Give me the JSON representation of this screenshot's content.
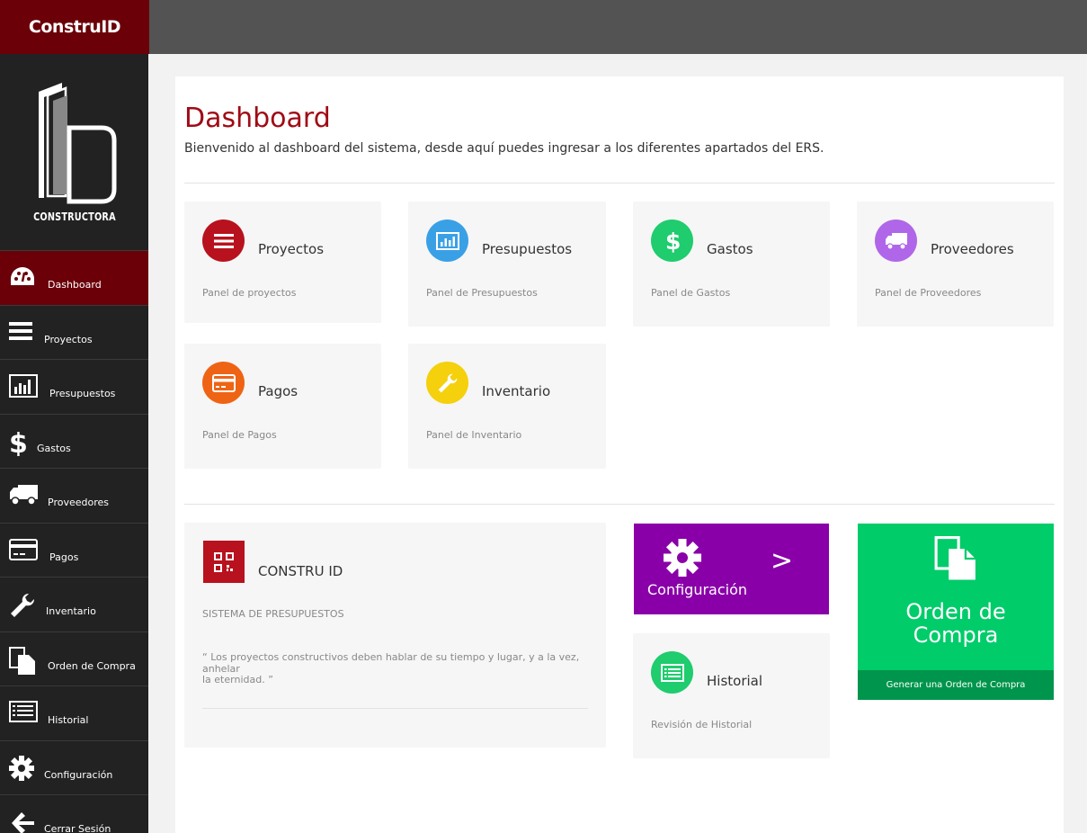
{
  "brand": "ConstruID",
  "logo_text": "CONSTRUCTORA",
  "sidebar": {
    "items": [
      {
        "label": "Dashboard",
        "icon": "dashboard-icon"
      },
      {
        "label": "Proyectos",
        "icon": "list-icon"
      },
      {
        "label": "Presupuestos",
        "icon": "bar-chart-icon"
      },
      {
        "label": "Gastos",
        "icon": "dollar-icon"
      },
      {
        "label": "Proveedores",
        "icon": "truck-icon"
      },
      {
        "label": "Pagos",
        "icon": "credit-card-icon"
      },
      {
        "label": "Inventario",
        "icon": "wrench-icon"
      },
      {
        "label": "Orden de Compra",
        "icon": "documents-icon"
      },
      {
        "label": "Historial",
        "icon": "history-list-icon"
      },
      {
        "label": "Configuración",
        "icon": "gear-icon"
      },
      {
        "label": "Cerrar Sesión",
        "icon": "arrow-left-icon"
      }
    ]
  },
  "main": {
    "title": "Dashboard",
    "subtitle": "Bienvenido al dashboard del sistema, desde aquí puedes ingresar a los diferentes apartados del ERS.",
    "cards": [
      {
        "title": "Proyectos",
        "desc": "Panel de proyectos",
        "color": "#b8121e",
        "icon": "list-icon"
      },
      {
        "title": "Presupuestos",
        "desc": "Panel de Presupuestos",
        "color": "#3aa0e6",
        "icon": "bar-chart-icon"
      },
      {
        "title": "Gastos",
        "desc": "Panel de Gastos",
        "color": "#1fcc6e",
        "icon": "dollar-icon"
      },
      {
        "title": "Proveedores",
        "desc": "Panel de Proveedores",
        "color": "#b066e8",
        "icon": "truck-icon"
      },
      {
        "title": "Pagos",
        "desc": "Panel de Pagos",
        "color": "#ee6414",
        "icon": "credit-card-icon"
      },
      {
        "title": "Inventario",
        "desc": "Panel de Inventario",
        "color": "#f5d00c",
        "icon": "wrench-icon"
      }
    ],
    "about": {
      "title": "CONSTRU ID",
      "subtitle": "SISTEMA DE PRESUPUESTOS",
      "quote_line1": "“ Los proyectos constructivos deben hablar de su tiempo y lugar, y a la vez, anhelar",
      "quote_line2": "la eternidad. ”",
      "icon": "qr-code-icon"
    },
    "config": {
      "label": "Configuración",
      "arrow": ">",
      "color": "#8a00a8"
    },
    "historial": {
      "title": "Historial",
      "desc": "Revisión de Historial",
      "color": "#1fcc6e"
    },
    "orden": {
      "title_line1": "Orden de",
      "title_line2": "Compra",
      "footer": "Generar una Orden de Compra",
      "color": "#00cc6a"
    }
  }
}
